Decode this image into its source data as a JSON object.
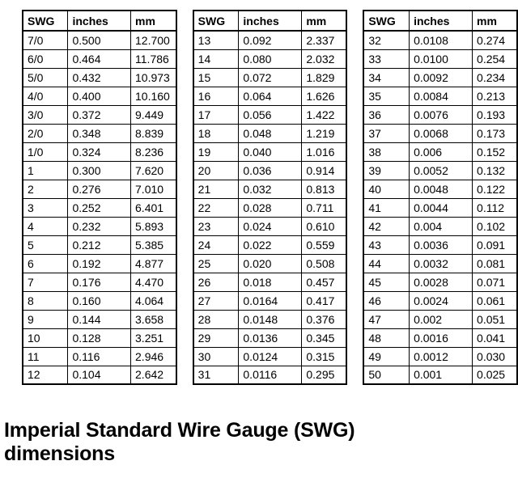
{
  "caption": "Imperial Standard Wire Gauge (SWG) dimensions",
  "columns": [
    "SWG",
    "inches",
    "mm"
  ],
  "colors": {
    "background": "#ffffff",
    "text": "#000000",
    "border": "#000000"
  },
  "chart_data": {
    "type": "table",
    "title": "Imperial Standard Wire Gauge (SWG) dimensions",
    "columns": [
      "SWG",
      "inches",
      "mm"
    ],
    "tables": [
      {
        "index": 0,
        "rows": [
          [
            "7/0",
            "0.500",
            "12.700"
          ],
          [
            "6/0",
            "0.464",
            "11.786"
          ],
          [
            "5/0",
            "0.432",
            "10.973"
          ],
          [
            "4/0",
            "0.400",
            "10.160"
          ],
          [
            "3/0",
            "0.372",
            "9.449"
          ],
          [
            "2/0",
            "0.348",
            "8.839"
          ],
          [
            "1/0",
            "0.324",
            "8.236"
          ],
          [
            "1",
            "0.300",
            "7.620"
          ],
          [
            "2",
            "0.276",
            "7.010"
          ],
          [
            "3",
            "0.252",
            "6.401"
          ],
          [
            "4",
            "0.232",
            "5.893"
          ],
          [
            "5",
            "0.212",
            "5.385"
          ],
          [
            "6",
            "0.192",
            "4.877"
          ],
          [
            "7",
            "0.176",
            "4.470"
          ],
          [
            "8",
            "0.160",
            "4.064"
          ],
          [
            "9",
            "0.144",
            "3.658"
          ],
          [
            "10",
            "0.128",
            "3.251"
          ],
          [
            "11",
            "0.116",
            "2.946"
          ],
          [
            "12",
            "0.104",
            "2.642"
          ]
        ]
      },
      {
        "index": 1,
        "rows": [
          [
            "13",
            "0.092",
            "2.337"
          ],
          [
            "14",
            "0.080",
            "2.032"
          ],
          [
            "15",
            "0.072",
            "1.829"
          ],
          [
            "16",
            "0.064",
            "1.626"
          ],
          [
            "17",
            "0.056",
            "1.422"
          ],
          [
            "18",
            "0.048",
            "1.219"
          ],
          [
            "19",
            "0.040",
            "1.016"
          ],
          [
            "20",
            "0.036",
            "0.914"
          ],
          [
            "21",
            "0.032",
            "0.813"
          ],
          [
            "22",
            "0.028",
            "0.711"
          ],
          [
            "23",
            "0.024",
            "0.610"
          ],
          [
            "24",
            "0.022",
            "0.559"
          ],
          [
            "25",
            "0.020",
            "0.508"
          ],
          [
            "26",
            "0.018",
            "0.457"
          ],
          [
            "27",
            "0.0164",
            "0.417"
          ],
          [
            "28",
            "0.0148",
            "0.376"
          ],
          [
            "29",
            "0.0136",
            "0.345"
          ],
          [
            "30",
            "0.0124",
            "0.315"
          ],
          [
            "31",
            "0.0116",
            "0.295"
          ]
        ]
      },
      {
        "index": 2,
        "rows": [
          [
            "32",
            "0.0108",
            "0.274"
          ],
          [
            "33",
            "0.0100",
            "0.254"
          ],
          [
            "34",
            "0.0092",
            "0.234"
          ],
          [
            "35",
            "0.0084",
            "0.213"
          ],
          [
            "36",
            "0.0076",
            "0.193"
          ],
          [
            "37",
            "0.0068",
            "0.173"
          ],
          [
            "38",
            "0.006",
            "0.152"
          ],
          [
            "39",
            "0.0052",
            "0.132"
          ],
          [
            "40",
            "0.0048",
            "0.122"
          ],
          [
            "41",
            "0.0044",
            "0.112"
          ],
          [
            "42",
            "0.004",
            "0.102"
          ],
          [
            "43",
            "0.0036",
            "0.091"
          ],
          [
            "44",
            "0.0032",
            "0.081"
          ],
          [
            "45",
            "0.0028",
            "0.071"
          ],
          [
            "46",
            "0.0024",
            "0.061"
          ],
          [
            "47",
            "0.002",
            "0.051"
          ],
          [
            "48",
            "0.0016",
            "0.041"
          ],
          [
            "49",
            "0.0012",
            "0.030"
          ],
          [
            "50",
            "0.001",
            "0.025"
          ]
        ]
      }
    ]
  }
}
